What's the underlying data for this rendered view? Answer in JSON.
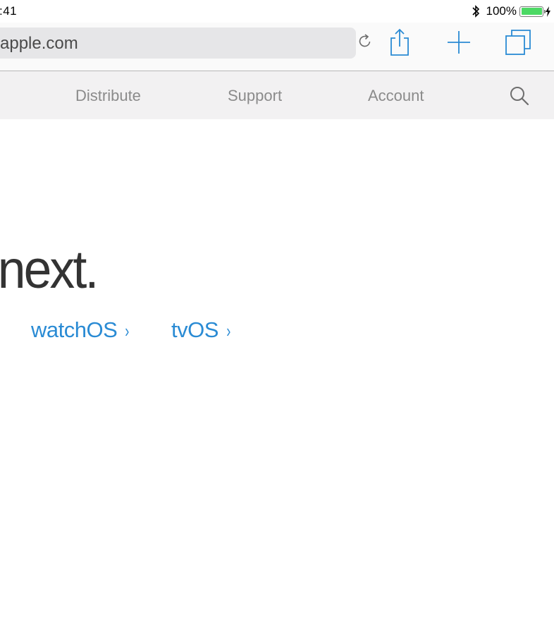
{
  "status_bar": {
    "time": ":41",
    "battery_percent": "100%",
    "battery_level": 1.0,
    "bluetooth_icon": "bluetooth-icon",
    "charging_icon": "lightning-bolt-icon"
  },
  "toolbar": {
    "url": "apple.com",
    "reload_icon": "reload-icon",
    "share_icon": "share-icon",
    "new_tab_icon": "plus-icon",
    "tabs_icon": "tabs-icon",
    "accent_color": "#2a8bd4"
  },
  "site_nav": {
    "items": [
      "Distribute",
      "Support",
      "Account"
    ],
    "search_icon": "search-icon"
  },
  "hero": {
    "headline": "t’s next.",
    "links": [
      {
        "label": "watchOS",
        "chevron": "›"
      },
      {
        "label": "tvOS",
        "chevron": "›"
      }
    ],
    "link_color": "#2a8bd4"
  }
}
